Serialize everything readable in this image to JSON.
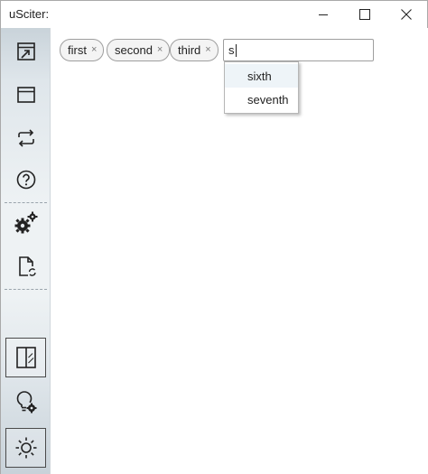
{
  "window": {
    "title": "uSciter:",
    "controls": {
      "minimize_icon": "minimize-icon",
      "maximize_icon": "maximize-icon",
      "close_icon": "close-icon"
    }
  },
  "sidebar": {
    "items": [
      {
        "name": "open-window-icon"
      },
      {
        "name": "window-icon"
      },
      {
        "name": "refresh-icon"
      },
      {
        "name": "help-icon"
      },
      {
        "name": "gears-icon"
      },
      {
        "name": "document-refresh-icon"
      },
      {
        "name": "split-view-icon",
        "pressed": true
      },
      {
        "name": "lightbulb-settings-icon"
      },
      {
        "name": "sun-icon",
        "pressed": true
      }
    ]
  },
  "tags": {
    "items": [
      {
        "label": "first",
        "remove": "×"
      },
      {
        "label": "second",
        "remove": "×"
      },
      {
        "label": "third",
        "remove": "×"
      }
    ],
    "input_value": "s"
  },
  "suggestions": {
    "items": [
      {
        "label": "sixth",
        "highlighted": true
      },
      {
        "label": "seventh",
        "highlighted": false
      }
    ]
  },
  "colors": {
    "border": "#9e9e9e",
    "highlight": "#eef4f8",
    "sidebar_top": "#c9d3da"
  }
}
